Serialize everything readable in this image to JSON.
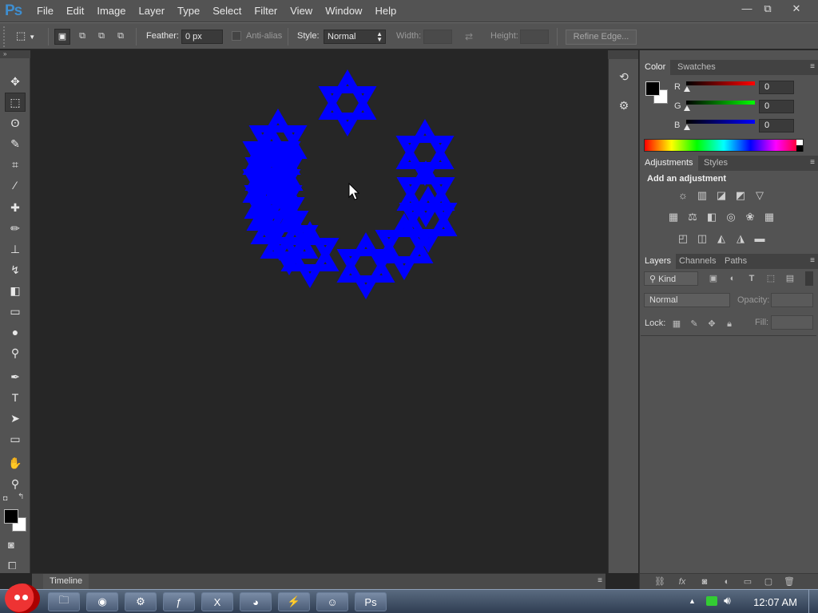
{
  "app": {
    "logo": "Ps"
  },
  "menu": [
    "File",
    "Edit",
    "Image",
    "Layer",
    "Type",
    "Select",
    "Filter",
    "View",
    "Window",
    "Help"
  ],
  "window_controls": {
    "minimize": "—",
    "restore": "⧉",
    "close": "✕"
  },
  "options": {
    "feather_label": "Feather:",
    "feather_value": "0 px",
    "antialias_label": "Anti-alias",
    "style_label": "Style:",
    "style_value": "Normal",
    "width_label": "Width:",
    "height_label": "Height:",
    "refine_edge": "Refine Edge..."
  },
  "tools": [
    {
      "name": "move-tool-icon",
      "glyph": "✥"
    },
    {
      "name": "rectangular-marquee-tool-icon",
      "glyph": "⬚",
      "active": true
    },
    {
      "name": "lasso-tool-icon",
      "glyph": "ʘ"
    },
    {
      "name": "quick-selection-tool-icon",
      "glyph": "✎"
    },
    {
      "name": "crop-tool-icon",
      "glyph": "⌗"
    },
    {
      "name": "eyedropper-tool-icon",
      "glyph": "⁄"
    },
    {
      "name": "healing-brush-tool-icon",
      "glyph": "✚"
    },
    {
      "name": "brush-tool-icon",
      "glyph": "✏"
    },
    {
      "name": "clone-stamp-tool-icon",
      "glyph": "⊥"
    },
    {
      "name": "history-brush-tool-icon",
      "glyph": "↯"
    },
    {
      "name": "eraser-tool-icon",
      "glyph": "◧"
    },
    {
      "name": "gradient-tool-icon",
      "glyph": "▭"
    },
    {
      "name": "blur-tool-icon",
      "glyph": "●"
    },
    {
      "name": "dodge-tool-icon",
      "glyph": "⚲"
    },
    {
      "name": "pen-tool-icon",
      "glyph": "✒"
    },
    {
      "name": "type-tool-icon",
      "glyph": "T"
    },
    {
      "name": "path-selection-tool-icon",
      "glyph": "➤"
    },
    {
      "name": "rectangle-tool-icon",
      "glyph": "▭"
    },
    {
      "name": "hand-tool-icon",
      "glyph": "✋"
    },
    {
      "name": "zoom-tool-icon",
      "glyph": "⚲"
    }
  ],
  "colors": {
    "foreground": "#000000",
    "background": "#ffffff",
    "shape": "#0000ff"
  },
  "color_panel": {
    "tabs": [
      "Color",
      "Swatches"
    ],
    "channels": [
      {
        "label": "R",
        "value": "0",
        "color": "#ff0000"
      },
      {
        "label": "G",
        "value": "0",
        "color": "#00ff00"
      },
      {
        "label": "B",
        "value": "0",
        "color": "#0000ff"
      }
    ]
  },
  "adjustments_panel": {
    "tabs": [
      "Adjustments",
      "Styles"
    ],
    "heading": "Add an adjustment"
  },
  "layers_panel": {
    "tabs": [
      "Layers",
      "Channels",
      "Paths"
    ],
    "kind_label": "Kind",
    "blend_mode": "Normal",
    "opacity_label": "Opacity:",
    "lock_label": "Lock:",
    "fill_label": "Fill:"
  },
  "timeline": {
    "label": "Timeline"
  },
  "taskbar": {
    "apps": [
      {
        "name": "explorer",
        "glyph": "🗀"
      },
      {
        "name": "chrome",
        "glyph": "◉"
      },
      {
        "name": "settings",
        "glyph": "⚙"
      },
      {
        "name": "flash",
        "glyph": "ƒ"
      },
      {
        "name": "excel",
        "glyph": "X"
      },
      {
        "name": "firefox",
        "glyph": "◕"
      },
      {
        "name": "flashget",
        "glyph": "⚡"
      },
      {
        "name": "messenger",
        "glyph": "☺"
      },
      {
        "name": "photoshop",
        "glyph": "Ps"
      }
    ],
    "clock": "12:07 AM"
  }
}
